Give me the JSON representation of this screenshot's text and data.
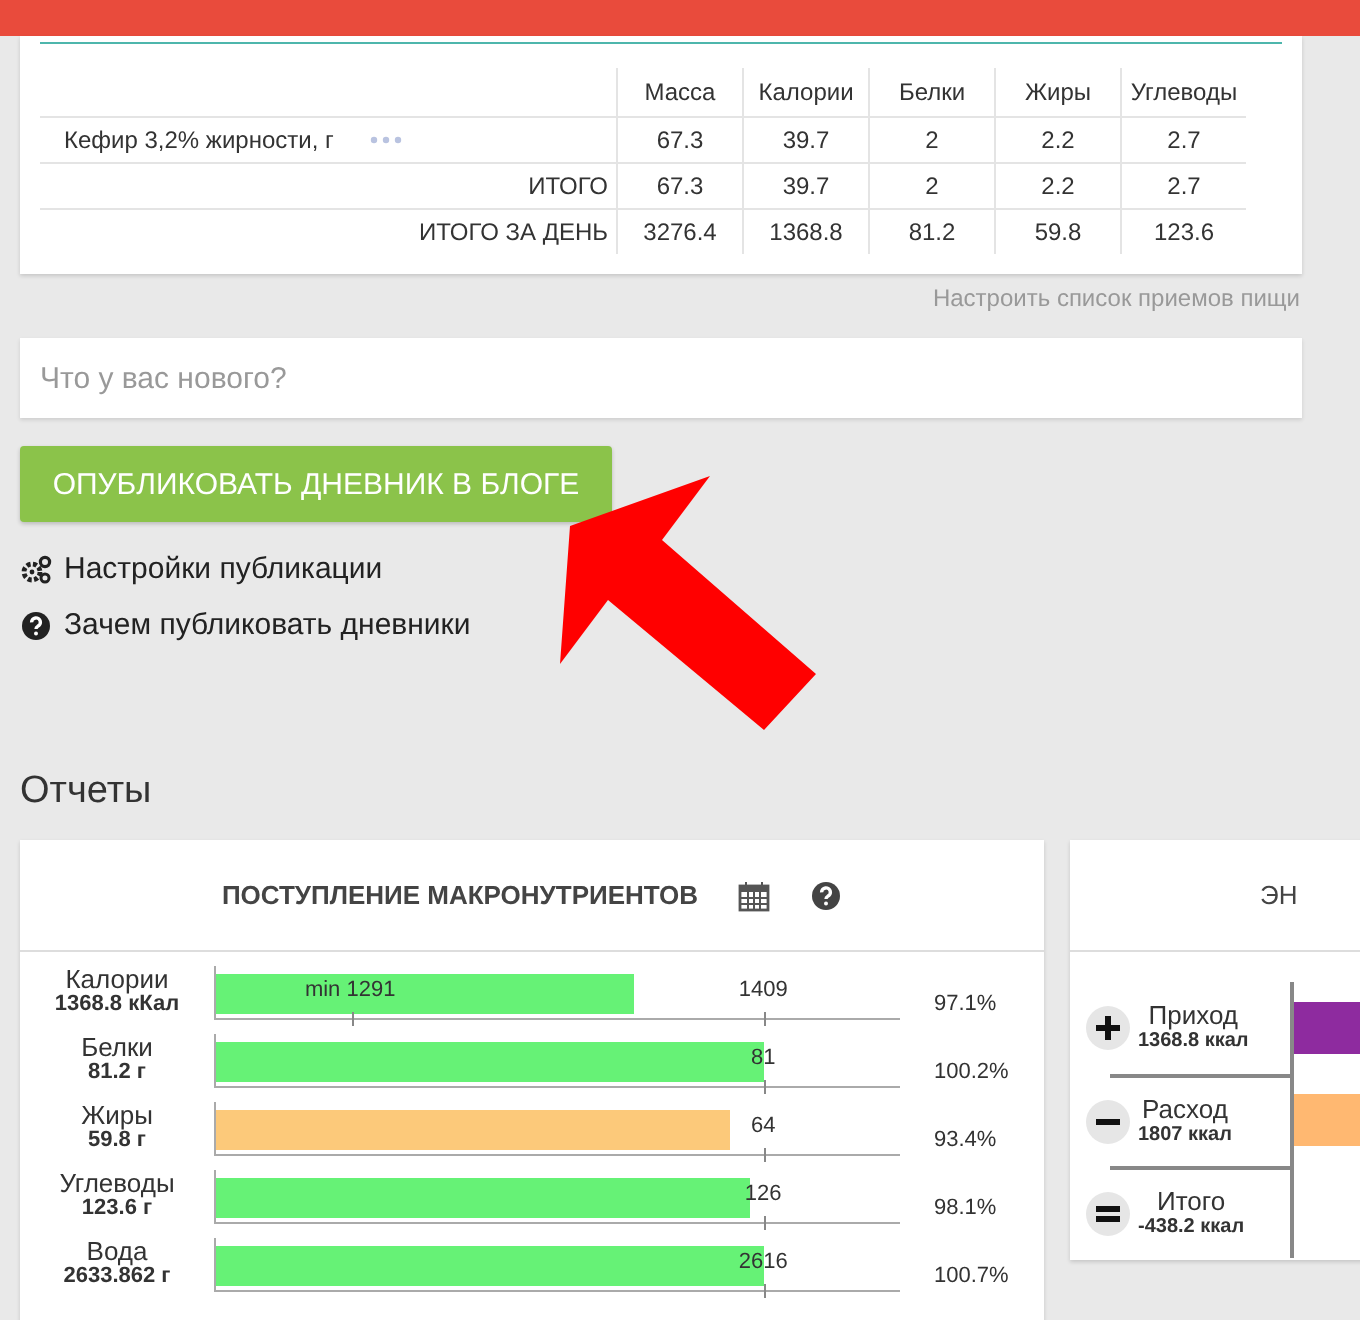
{
  "food_table": {
    "columns": [
      "Масса",
      "Калории",
      "Белки",
      "Жиры",
      "Углеводы"
    ],
    "rows": [
      {
        "kind": "food",
        "label": "Кефир 3,2% жирности, г",
        "cells": [
          "67.3",
          "39.7",
          "2",
          "2.2",
          "2.7"
        ]
      },
      {
        "kind": "total",
        "label": "ИТОГО",
        "cells": [
          "67.3",
          "39.7",
          "2",
          "2.2",
          "2.7"
        ]
      },
      {
        "kind": "total",
        "label": "ИТОГО ЗА ДЕНЬ",
        "cells": [
          "3276.4",
          "1368.8",
          "81.2",
          "59.8",
          "123.6"
        ]
      }
    ]
  },
  "configure_link": "Настроить список приемов пищи",
  "post_field": {
    "placeholder": "Что у вас нового?"
  },
  "publish_button": "ОПУБЛИКОВАТЬ ДНЕВНИК В БЛОГЕ",
  "links": [
    {
      "kind": "settings",
      "label": "Настройки публикации"
    },
    {
      "kind": "help",
      "label": "Зачем публиковать дневники"
    }
  ],
  "reports_title": "Отчеты",
  "macro_card": {
    "title": "ПОСТУПЛЕНИЕ МАКРОНУТРИЕНТОВ",
    "rows": [
      {
        "name": "Калории",
        "amount": "1368.8 кКал",
        "level": 0.61,
        "color": "#66f276",
        "min_label": "min 1291",
        "target": "1409",
        "percent": "97.1%"
      },
      {
        "name": "Белки",
        "amount": "81.2 г",
        "level": 0.8,
        "color": "#66f276",
        "target": "81",
        "percent": "100.2%"
      },
      {
        "name": "Жиры",
        "amount": "59.8 г",
        "level": 0.75,
        "color": "#fcc97a",
        "target": "64",
        "percent": "93.4%"
      },
      {
        "name": "Углеводы",
        "amount": "123.6 г",
        "level": 0.78,
        "color": "#66f276",
        "target": "126",
        "percent": "98.1%"
      },
      {
        "name": "Вода",
        "amount": "2633.862 г",
        "level": 0.8,
        "color": "#66f276",
        "target": "2616",
        "percent": "100.7%"
      }
    ]
  },
  "energy_card": {
    "title": "ЭН",
    "rows": [
      {
        "kind": "income",
        "name": "Приход",
        "amount": "1368.8 ккал",
        "color": "#8e2b9f"
      },
      {
        "kind": "expense",
        "name": "Расход",
        "amount": "1807 ккал",
        "color": "#ffb871"
      },
      {
        "kind": "total",
        "name": "Итого",
        "amount": "-438.2 ккал"
      }
    ]
  }
}
